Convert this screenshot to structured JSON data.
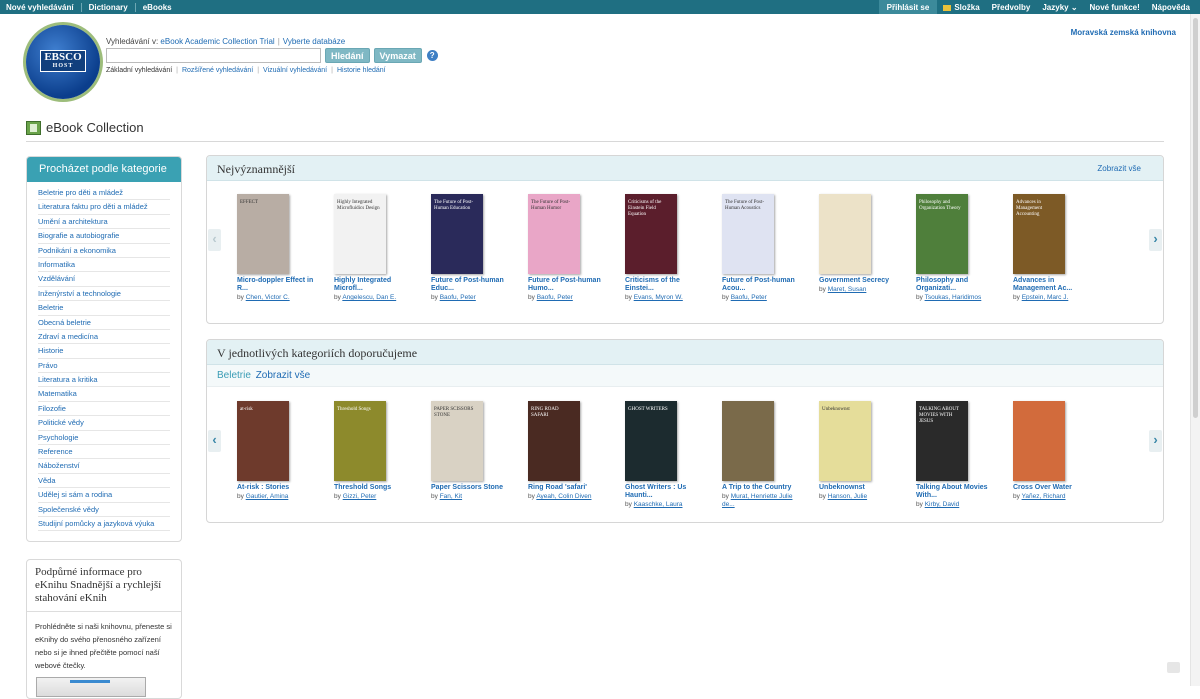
{
  "topbar": {
    "left": [
      "Nové vyhledávání",
      "Dictionary",
      "eBooks"
    ],
    "signin": "Přihlásit se",
    "folder": "Složka",
    "prefs": "Předvolby",
    "languages": "Jazyky ⌄",
    "new_features": "Nové funkce!",
    "help": "Nápověda"
  },
  "logo": {
    "top": "EBSCO",
    "bottom": "HOST"
  },
  "search": {
    "context_label": "Vyhledávání v:",
    "database": "eBook Academic Collection Trial",
    "choose_db": "Vyberte databáze",
    "search_btn": "Hledání",
    "clear_btn": "Vymazat",
    "help_icon": "?",
    "modes": [
      "Základní vyhledávání",
      "Rozšířené vyhledávání",
      "Vizuální vyhledávání",
      "Historie hledání"
    ]
  },
  "library_name": "Moravská zemská knihovna",
  "page_title": "eBook Collection",
  "categories": {
    "header": "Procházet podle kategorie",
    "items": [
      "Beletrie pro děti a mládež",
      "Literatura faktu pro děti a mládež",
      "Umění a architektura",
      "Biografie a autobiografie",
      "Podnikání a ekonomika",
      "Informatika",
      "Vzdělávání",
      "Inženýrství a technologie",
      "Beletrie",
      "Obecná beletrie",
      "Zdraví a medicína",
      "Historie",
      "Právo",
      "Literatura a kritika",
      "Matematika",
      "Filozofie",
      "Politické vědy",
      "Psychologie",
      "Reference",
      "Náboženství",
      "Věda",
      "Udělej si sám a rodina",
      "Společenské vědy",
      "Studijní pomůcky a jazyková výuka"
    ]
  },
  "support": {
    "title": "Podpůrné informace pro eKnihu Snadnější a rychlejší stahování eKnih",
    "text": "Prohlédněte si naši knihovnu, přeneste si eKnihy do svého přenosného zařízení nebo si je ihned přečtěte pomocí naší webové čtečky."
  },
  "popular": {
    "title": "Nejvýznamnější",
    "more": "Zobrazit vše",
    "books": [
      {
        "title": "Micro-doppler Effect in R...",
        "by": "by",
        "author": "Chen, Victor C.",
        "cover_text": "EFFECT",
        "color": "#b8ada4"
      },
      {
        "title": "Highly Integrated Microfl...",
        "by": "by",
        "author": "Angelescu, Dan E.",
        "cover_text": "Highly Integrated Microfluidics Design",
        "color": "#f2f2f2"
      },
      {
        "title": "Future of Post-human Educ...",
        "by": "by",
        "author": "Baofu, Peter",
        "cover_text": "The Future of Post-Human Education",
        "color": "#2a2a5a"
      },
      {
        "title": "Future of Post-human Humo...",
        "by": "by",
        "author": "Baofu, Peter",
        "cover_text": "The Future of Post-Human Humor",
        "color": "#e9a6c7"
      },
      {
        "title": "Criticisms of the Einstei...",
        "by": "by",
        "author": "Evans, Myron W.",
        "cover_text": "Criticisms of the Einstein Field Equation",
        "color": "#5b1e2c"
      },
      {
        "title": "Future of Post-human Acou...",
        "by": "by",
        "author": "Baofu, Peter",
        "cover_text": "The Future of Post-Human Acoustics",
        "color": "#dfe3f2"
      },
      {
        "title": "Government Secrecy",
        "by": "by",
        "author": "Maret, Susan",
        "cover_text": "",
        "color": "#ece2c8"
      },
      {
        "title": "Philosophy and Organizati...",
        "by": "by",
        "author": "Tsoukas, Haridimos",
        "cover_text": "Philosophy and Organization Theory",
        "color": "#4f7f3b"
      },
      {
        "title": "Advances in Management Ac...",
        "by": "by",
        "author": "Epstein, Marc J.",
        "cover_text": "Advances in Management Accounting",
        "color": "#7d5a26"
      }
    ]
  },
  "recommended": {
    "title": "V jednotlivých kategoriích doporučujeme",
    "category": "Beletrie",
    "more": "Zobrazit vše",
    "books": [
      {
        "title": "At-risk : Stories",
        "by": "by",
        "author": "Gautier, Amina",
        "cover_text": "at-risk",
        "color": "#6e3a2c"
      },
      {
        "title": "Threshold Songs",
        "by": "by",
        "author": "Gizzi, Peter",
        "cover_text": "Threshold Songs",
        "color": "#8d8a2c"
      },
      {
        "title": "Paper Scissors Stone",
        "by": "by",
        "author": "Fan, Kit",
        "cover_text": "PAPER SCISSORS STONE",
        "color": "#d9d2c4"
      },
      {
        "title": "Ring Road 'safari'",
        "by": "by",
        "author": "Ayeah, Colin Diven",
        "cover_text": "RING ROAD SAFARI",
        "color": "#4a2a22"
      },
      {
        "title": "Ghost Writers : Us Haunti...",
        "by": "by",
        "author": "Kaaschke, Laura",
        "cover_text": "GHOST WRITERS",
        "color": "#1c2b2f"
      },
      {
        "title": "A Trip to the Country",
        "by": "by",
        "author": "Murat, Henriette Julie de...",
        "cover_text": "",
        "color": "#7a6a4a"
      },
      {
        "title": "Unbeknownst",
        "by": "by",
        "author": "Hanson, Julie",
        "cover_text": "Unbeknownst",
        "color": "#e5dd9a"
      },
      {
        "title": "Talking About Movies With...",
        "by": "by",
        "author": "Kirby, David",
        "cover_text": "TALKING ABOUT MOVIES WITH JESUS",
        "color": "#2a2a2a"
      },
      {
        "title": "Cross Over Water",
        "by": "by",
        "author": "Yañez, Richard",
        "cover_text": "",
        "color": "#d26b3c"
      }
    ]
  }
}
